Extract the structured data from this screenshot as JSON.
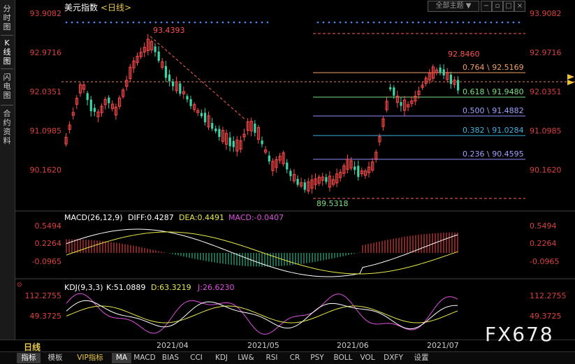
{
  "sidebar": {
    "tabs": [
      {
        "label": "分时图",
        "active": false
      },
      {
        "label": "K线图",
        "active": true
      },
      {
        "label": "闪电图",
        "active": false
      },
      {
        "label": "合约资料",
        "active": false
      }
    ]
  },
  "header": {
    "symbol": "美元指数",
    "period": "<日线>",
    "theme_dropdown": "全部主题"
  },
  "price_axis": [
    "93.9082",
    "92.9716",
    "92.0351",
    "91.0985",
    "90.1620"
  ],
  "main_chart": {
    "high_label": "93.4393",
    "low_label": "89.5318",
    "recent_high_label": "92.8460",
    "fibonacci": [
      {
        "label": "0.764 \\ 92.5169",
        "color": "#f0a060"
      },
      {
        "label": "0.618 \\ 91.9480",
        "color": "#7ee07e"
      },
      {
        "label": "0.500 \\ 91.4882",
        "color": "#a0a0ff"
      },
      {
        "label": "0.382 \\ 91.0284",
        "color": "#40b0e0"
      },
      {
        "label": "0.236 \\ 90.4595",
        "color": "#a0a0ff"
      }
    ]
  },
  "macd": {
    "title": "MACD(26,12,9)",
    "diff": "DIFF:0.4287",
    "dea": "DEA:0.4491",
    "macd": "MACD:-0.0407",
    "axis": [
      "0.5494",
      "0.2264",
      "-0.0965"
    ]
  },
  "kdj": {
    "title": "KDJ(9,3,3)",
    "k": "K:51.0889",
    "d": "D:63.3219",
    "j": "J:26.6230",
    "axis": [
      "112.2755",
      "49.3725"
    ]
  },
  "dates": [
    "2021/04",
    "2021/05",
    "2021/06",
    "2021/07"
  ],
  "period_label": "日线",
  "bottom_tabs": [
    "指标",
    "模板",
    "VIP指标",
    "MA",
    "MACD",
    "BIAS",
    "CCI",
    "KDJ",
    "LW&",
    "RSI",
    "CR",
    "PSY",
    "BOLL",
    "VOL",
    "DXFY",
    "设置"
  ],
  "watermark": "FX678",
  "colors": {
    "up": "#ff4a4a",
    "down": "#3fd3a8",
    "axis": "#d94040"
  }
}
